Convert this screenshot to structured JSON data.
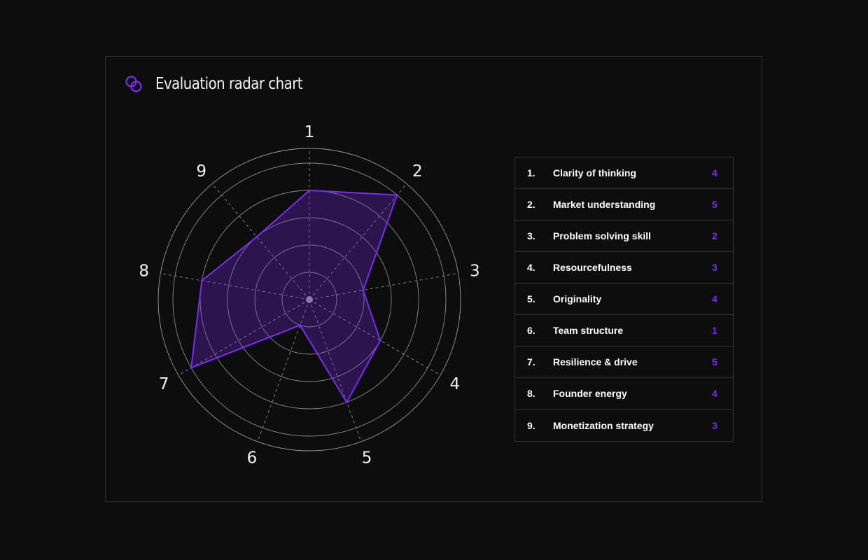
{
  "title": "Evaluation radar chart",
  "icon": "linked-circles-icon",
  "accent": "#7a2cf0",
  "chart_data": {
    "type": "radar",
    "categories": [
      "1",
      "2",
      "3",
      "4",
      "5",
      "6",
      "7",
      "8",
      "9"
    ],
    "max": 5,
    "values": [
      4,
      5,
      2,
      3,
      4,
      1,
      5,
      4,
      3
    ],
    "rings": 5
  },
  "legend": [
    {
      "num": "1.",
      "label": "Clarity of thinking",
      "score": "4"
    },
    {
      "num": "2.",
      "label": "Market understanding",
      "score": "5"
    },
    {
      "num": "3.",
      "label": "Problem solving skill",
      "score": "2"
    },
    {
      "num": "4.",
      "label": "Resourcefulness",
      "score": "3"
    },
    {
      "num": "5.",
      "label": "Originality",
      "score": "4"
    },
    {
      "num": "6.",
      "label": "Team structure",
      "score": "1"
    },
    {
      "num": "7.",
      "label": "Resilience & drive",
      "score": "5"
    },
    {
      "num": "8.",
      "label": "Founder energy",
      "score": "4"
    },
    {
      "num": "9.",
      "label": "Monetization strategy",
      "score": "3"
    }
  ]
}
